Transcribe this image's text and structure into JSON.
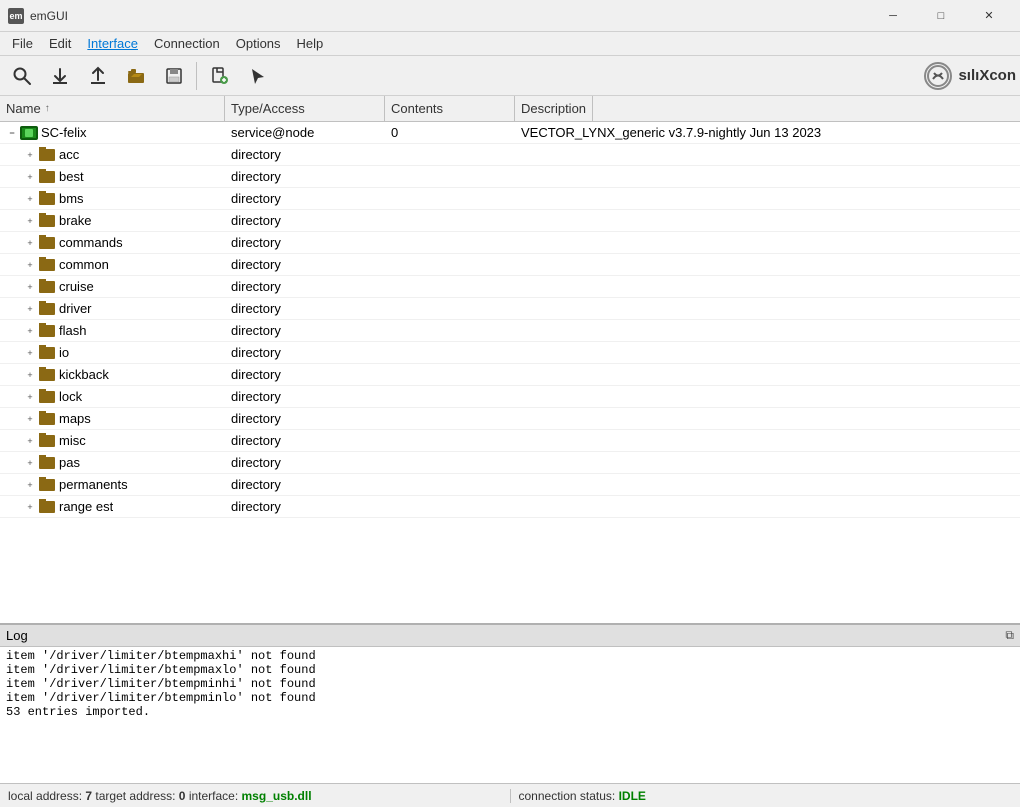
{
  "titleBar": {
    "appIcon": "em",
    "title": "emGUI",
    "minimizeLabel": "─",
    "maximizeLabel": "□",
    "closeLabel": "✕"
  },
  "menuBar": {
    "items": [
      {
        "label": "File",
        "active": false
      },
      {
        "label": "Edit",
        "active": false
      },
      {
        "label": "Interface",
        "active": true
      },
      {
        "label": "Connection",
        "active": false
      },
      {
        "label": "Options",
        "active": false
      },
      {
        "label": "Help",
        "active": false
      }
    ]
  },
  "toolbar": {
    "buttons": [
      {
        "name": "search-button",
        "icon": "🔍"
      },
      {
        "name": "download-button",
        "icon": "⬇"
      },
      {
        "name": "upload-button",
        "icon": "⬆"
      },
      {
        "name": "open-button",
        "icon": "📂"
      },
      {
        "name": "save-button",
        "icon": "💾"
      }
    ],
    "buttons2": [
      {
        "name": "add-button",
        "icon": "📄"
      },
      {
        "name": "cursor-button",
        "icon": "☞"
      }
    ],
    "logoText": "sılıXcon"
  },
  "columns": {
    "name": {
      "label": "Name",
      "sortArrow": "↑"
    },
    "typeAccess": {
      "label": "Type/Access"
    },
    "contents": {
      "label": "Contents"
    },
    "description": {
      "label": "Description"
    }
  },
  "tree": {
    "root": {
      "label": "SC-felix",
      "type": "service@node",
      "contents": "0",
      "description": "VECTOR_LYNX_generic v3.7.9-nightly Jun 13 2023",
      "expanded": true
    },
    "children": [
      {
        "label": "acc",
        "type": "directory"
      },
      {
        "label": "best",
        "type": "directory"
      },
      {
        "label": "bms",
        "type": "directory"
      },
      {
        "label": "brake",
        "type": "directory"
      },
      {
        "label": "commands",
        "type": "directory"
      },
      {
        "label": "common",
        "type": "directory"
      },
      {
        "label": "cruise",
        "type": "directory"
      },
      {
        "label": "driver",
        "type": "directory"
      },
      {
        "label": "flash",
        "type": "directory"
      },
      {
        "label": "io",
        "type": "directory"
      },
      {
        "label": "kickback",
        "type": "directory"
      },
      {
        "label": "lock",
        "type": "directory"
      },
      {
        "label": "maps",
        "type": "directory"
      },
      {
        "label": "misc",
        "type": "directory"
      },
      {
        "label": "pas",
        "type": "directory"
      },
      {
        "label": "permanents",
        "type": "directory"
      },
      {
        "label": "range est",
        "type": "directory"
      }
    ]
  },
  "log": {
    "title": "Log",
    "restoreIcon": "⧉",
    "entries": [
      "item '/driver/limiter/btempmaxhi' not found",
      "item '/driver/limiter/btempmaxlo' not found",
      "item '/driver/limiter/btempminhi' not found",
      "item '/driver/limiter/btempminlo' not found",
      "53 entries imported."
    ]
  },
  "statusBar": {
    "localLabel": "local address:",
    "localValue": "7",
    "targetLabel": "target address:",
    "targetValue": "0",
    "interfaceLabel": "interface:",
    "interfaceValue": "msg_usb.dll",
    "connectionLabel": "connection status:",
    "connectionValue": "IDLE"
  }
}
